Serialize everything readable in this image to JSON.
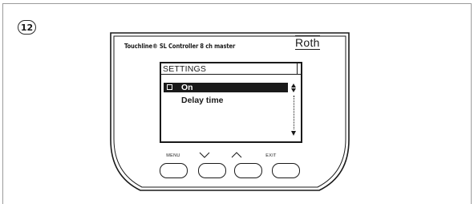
{
  "figure": {
    "step_number": "12"
  },
  "device": {
    "title": "Touchline® SL Controller 8 ch master",
    "brand": "Roth"
  },
  "screen": {
    "title": "SETTINGS",
    "items": [
      {
        "label": "On",
        "selected": true
      },
      {
        "label": "Delay time",
        "selected": false
      }
    ]
  },
  "buttons": {
    "menu_label": "MENU",
    "down_icon": "chevron-down-icon",
    "up_icon": "chevron-up-icon",
    "exit_label": "EXIT"
  },
  "colors": {
    "ink": "#1a1a1a",
    "background": "#ffffff",
    "frame": "#9b9b9b"
  }
}
